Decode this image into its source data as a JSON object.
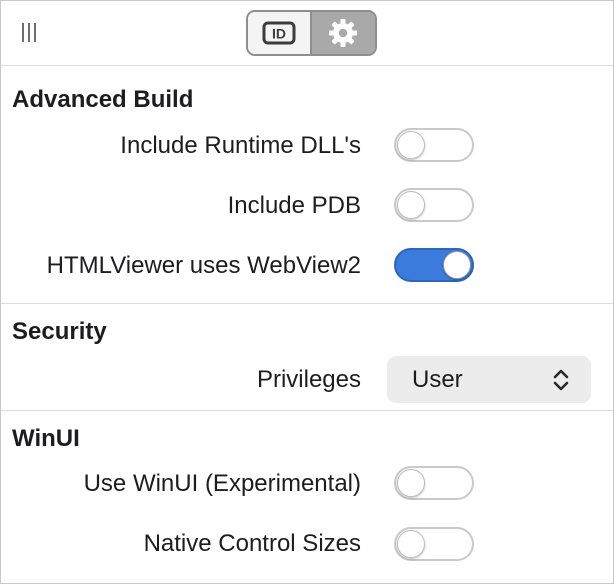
{
  "toolbar": {
    "segments": [
      {
        "name": "id-inspector",
        "label": "ID",
        "selected": false
      },
      {
        "name": "settings",
        "icon": "gear-icon",
        "selected": true
      }
    ]
  },
  "sections": {
    "advanced_build": {
      "title": "Advanced Build",
      "rows": [
        {
          "label": "Include Runtime DLL's",
          "value": false
        },
        {
          "label": "Include PDB",
          "value": false
        },
        {
          "label": "HTMLViewer uses WebView2",
          "value": true
        }
      ]
    },
    "security": {
      "title": "Security",
      "privileges": {
        "label": "Privileges",
        "value": "User"
      }
    },
    "winui": {
      "title": "WinUI",
      "rows": [
        {
          "label": "Use WinUI (Experimental)",
          "value": false
        },
        {
          "label": "Native Control Sizes",
          "value": false
        }
      ]
    }
  },
  "colors": {
    "accent": "#3a7bdc",
    "divider": "#dcdcdc",
    "select_bg": "#ececec"
  }
}
